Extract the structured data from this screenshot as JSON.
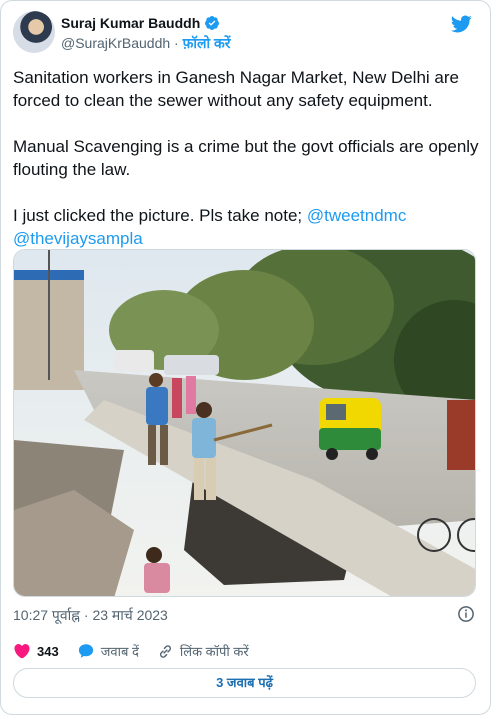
{
  "author": {
    "name": "Suraj Kumar Bauddh",
    "handle": "@SurajKrBauddh",
    "separator": " · ",
    "follow_label": "फ़ॉलो करें"
  },
  "tweet": {
    "para1": "Sanitation workers in Ganesh Nagar Market, New Delhi are forced to clean the sewer without any safety equipment.",
    "para2": "Manual Scavenging is a crime but the govt officials are openly flouting the law.",
    "para3_text": "I just clicked the picture. Pls take note; ",
    "mention1": "@tweetndmc",
    "mention2": "@thevijaysampla"
  },
  "meta": {
    "time": "10:27 पूर्वाह्न",
    "separator": " · ",
    "date": "23 मार्च 2023"
  },
  "actions": {
    "like_count": "343",
    "reply_label": "जवाब दें",
    "copy_link_label": "लिंक कॉपी करें"
  },
  "replies_button": "3 जवाब पढ़ें",
  "colors": {
    "accent": "#1d9bf0",
    "like": "#f91880",
    "text": "#0f1419",
    "muted": "#536471",
    "border": "#cfd9de"
  },
  "icons": [
    "verified-badge-icon",
    "twitter-bird-icon",
    "info-icon",
    "heart-icon",
    "reply-bubble-icon",
    "link-icon"
  ]
}
